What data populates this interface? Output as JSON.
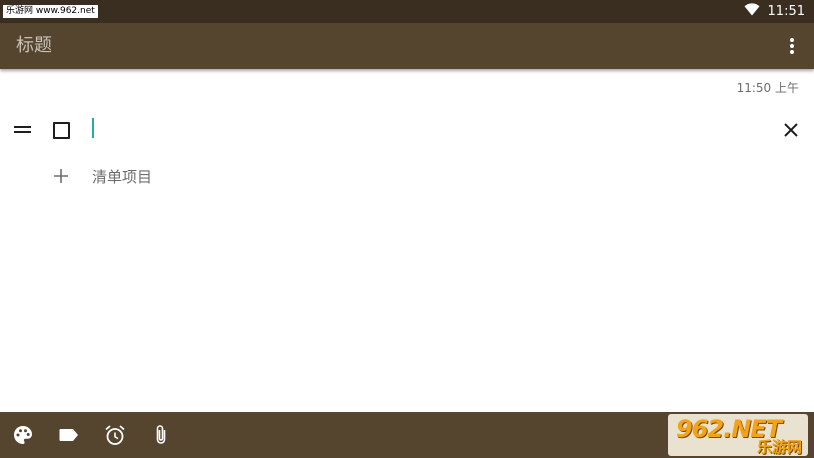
{
  "status_bar": {
    "watermark_text": "乐游网 www.962.net",
    "time": "11:51"
  },
  "app_bar": {
    "title": "标题",
    "overflow_icon": "more-vert-icon"
  },
  "note": {
    "timestamp": "11:50 上午",
    "items": [
      {
        "text": "",
        "checked": false
      }
    ],
    "add_item_label": "清单项目"
  },
  "bottom_toolbar": {
    "icons": [
      "palette-icon",
      "label-icon",
      "alarm-icon",
      "attachment-icon"
    ]
  },
  "watermark": {
    "line1": "962.NET",
    "line2": "乐游网"
  },
  "colors": {
    "status_bar": "#3a2e20",
    "app_bar": "#55452f",
    "accent_caret": "#2aa3b8"
  }
}
